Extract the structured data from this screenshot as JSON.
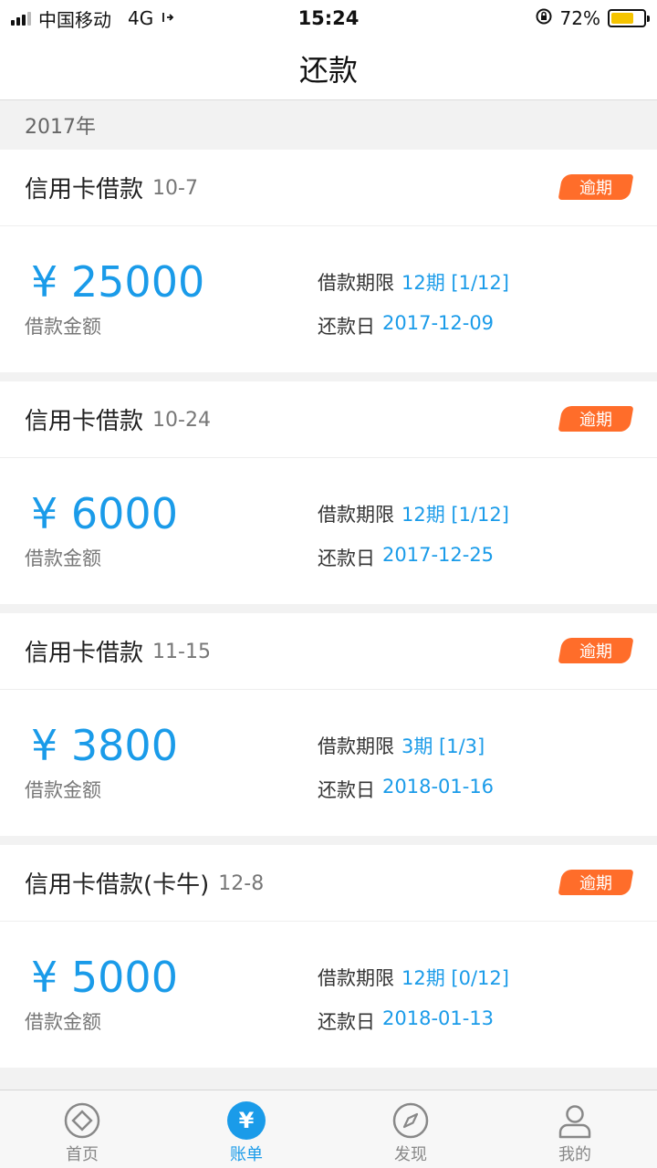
{
  "status_bar": {
    "carrier": "中国移动",
    "network": "4G",
    "time": "15:24",
    "battery_percent": "72%",
    "battery_level": 0.72
  },
  "header": {
    "title": "还款"
  },
  "section": {
    "year": "2017年"
  },
  "loans": [
    {
      "title": "信用卡借款",
      "date": "10-7",
      "badge": "逾期",
      "amount": "¥ 25000",
      "amount_label": "借款金额",
      "term_label": "借款期限",
      "term_value": "12期 [1/12]",
      "due_label": "还款日",
      "due_value": "2017-12-09"
    },
    {
      "title": "信用卡借款",
      "date": "10-24",
      "badge": "逾期",
      "amount": "¥ 6000",
      "amount_label": "借款金额",
      "term_label": "借款期限",
      "term_value": "12期 [1/12]",
      "due_label": "还款日",
      "due_value": "2017-12-25"
    },
    {
      "title": "信用卡借款",
      "date": "11-15",
      "badge": "逾期",
      "amount": "¥ 3800",
      "amount_label": "借款金额",
      "term_label": "借款期限",
      "term_value": "3期 [1/3]",
      "due_label": "还款日",
      "due_value": "2018-01-16"
    },
    {
      "title": "信用卡借款(卡牛)",
      "date": "12-8",
      "badge": "逾期",
      "amount": "¥ 5000",
      "amount_label": "借款金额",
      "term_label": "借款期限",
      "term_value": "12期 [0/12]",
      "due_label": "还款日",
      "due_value": "2018-01-13"
    }
  ],
  "tabs": [
    {
      "label": "首页",
      "icon": "home-icon"
    },
    {
      "label": "账单",
      "icon": "yen-icon",
      "active": true
    },
    {
      "label": "发现",
      "icon": "compass-icon"
    },
    {
      "label": "我的",
      "icon": "user-icon"
    }
  ],
  "colors": {
    "accent": "#1a9be9",
    "overdue_badge": "#ff6d2a",
    "battery": "#f5c400"
  }
}
